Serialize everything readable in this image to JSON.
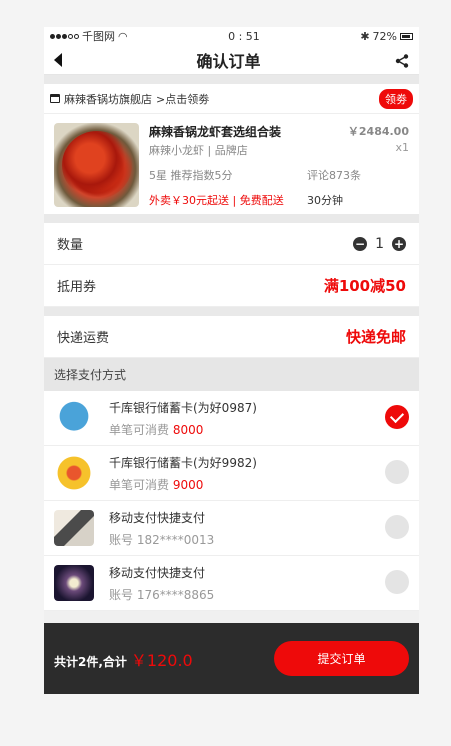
{
  "status": {
    "carrier": "千图网",
    "time": "0 : 51",
    "battery": "72%"
  },
  "nav": {
    "title": "确认订单"
  },
  "shop": {
    "name": "麻辣香锅坊旗舰店",
    "link": ">点击领劵",
    "coupon_label": "领劵"
  },
  "product": {
    "name": "麻辣香锅龙虾套选组合装",
    "price": "￥2484.00",
    "sub": "麻辣小龙虾 | 品牌店",
    "qty": "x1",
    "rating": "5星 推荐指数5分",
    "reviews": "评论873条",
    "delivery": "外卖￥30元起送 | 免费配送",
    "time": "30分钟"
  },
  "quantity": {
    "label": "数量",
    "minus": "−",
    "value": "1",
    "plus": "+"
  },
  "voucher": {
    "label": "抵用券",
    "value": "满100减50"
  },
  "shipping": {
    "label": "快递运费",
    "value": "快递免邮"
  },
  "payment": {
    "header": "选择支付方式",
    "methods": [
      {
        "title": "千库银行储蓄卡(为好0987)",
        "sub_label": "单笔可消费",
        "sub_value": "8000",
        "checked": true
      },
      {
        "title": "千库银行储蓄卡(为好9982)",
        "sub_label": "单笔可消费",
        "sub_value": "9000",
        "checked": false
      },
      {
        "title": "移动支付快捷支付",
        "sub_label": "账号 182****0013",
        "sub_value": "",
        "checked": false
      },
      {
        "title": "移动支付快捷支付",
        "sub_label": "账号 176****8865",
        "sub_value": "",
        "checked": false
      }
    ]
  },
  "footer": {
    "total_label": "共计2件,合计",
    "total_amount": "￥120.0",
    "submit_label": "提交订单"
  },
  "colors": {
    "accent": "#ee0a0a",
    "footer_bg": "#2c2c2c"
  }
}
